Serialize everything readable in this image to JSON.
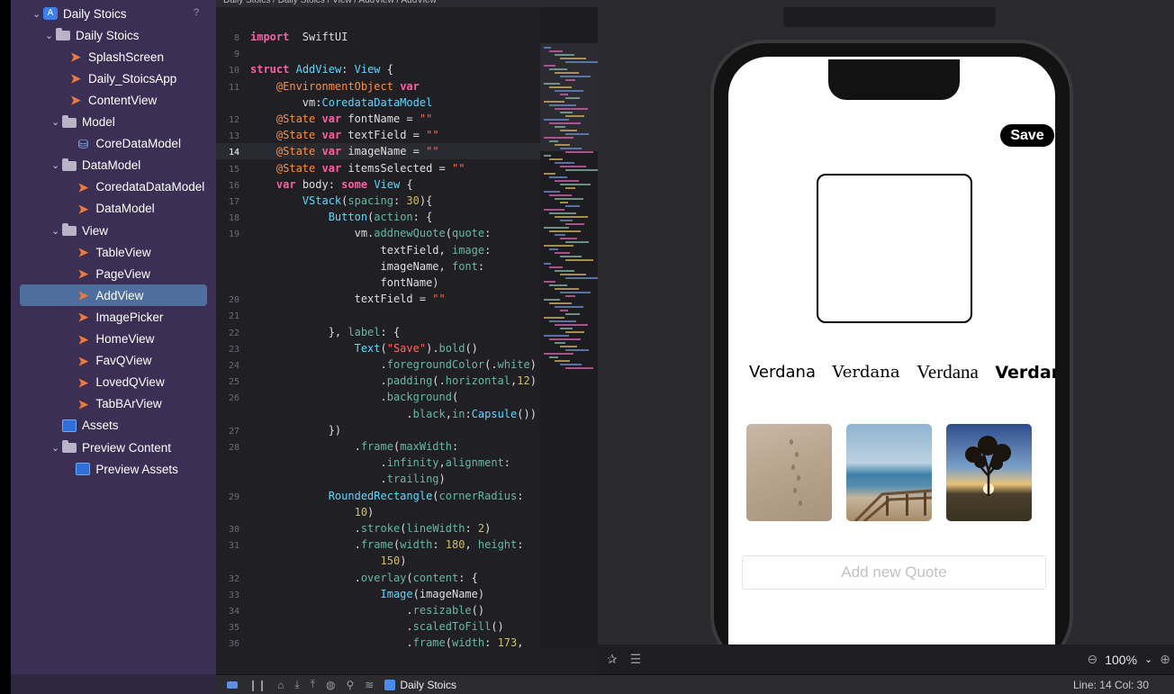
{
  "navigator": {
    "help_mark": "?",
    "tree": [
      {
        "label": "Daily Stoics",
        "icon": "project-icon",
        "indent": 0,
        "chev": "⌄"
      },
      {
        "label": "Daily Stoics",
        "icon": "folder-icon",
        "indent": 1,
        "chev": "⌄"
      },
      {
        "label": "SplashScreen",
        "icon": "swift-file-icon",
        "indent": 2
      },
      {
        "label": "Daily_StoicsApp",
        "icon": "swift-file-icon",
        "indent": 2
      },
      {
        "label": "ContentView",
        "icon": "swift-file-icon",
        "indent": 2
      },
      {
        "label": "Model",
        "icon": "folder-icon",
        "indent": 1.5,
        "chev": "⌄"
      },
      {
        "label": "CoreDataModel",
        "icon": "coredata-icon",
        "indent": 2.6
      },
      {
        "label": "DataModel",
        "icon": "folder-icon",
        "indent": 1.5,
        "chev": "⌄"
      },
      {
        "label": "CoredataDataModel",
        "icon": "swift-file-icon",
        "indent": 2.6
      },
      {
        "label": "DataModel",
        "icon": "swift-file-icon",
        "indent": 2.6
      },
      {
        "label": "View",
        "icon": "folder-icon",
        "indent": 1.5,
        "chev": "⌄"
      },
      {
        "label": "TableView",
        "icon": "swift-file-icon",
        "indent": 2.6
      },
      {
        "label": "PageView",
        "icon": "swift-file-icon",
        "indent": 2.6
      },
      {
        "label": "AddView",
        "icon": "swift-file-icon",
        "indent": 2.6,
        "selected": true
      },
      {
        "label": "ImagePicker",
        "icon": "swift-file-icon",
        "indent": 2.6
      },
      {
        "label": "HomeView",
        "icon": "swift-file-icon",
        "indent": 2.6
      },
      {
        "label": "FavQView",
        "icon": "swift-file-icon",
        "indent": 2.6
      },
      {
        "label": "LovedQView",
        "icon": "swift-file-icon",
        "indent": 2.6
      },
      {
        "label": "TabBArView",
        "icon": "swift-file-icon",
        "indent": 2.6
      },
      {
        "label": "Assets",
        "icon": "assets-icon",
        "indent": 1.5
      },
      {
        "label": "Preview Content",
        "icon": "folder-icon",
        "indent": 1.5,
        "chev": "⌄"
      },
      {
        "label": "Preview Assets",
        "icon": "assets-icon",
        "indent": 2.6
      }
    ]
  },
  "editor": {
    "breadcrumb": "Daily Stoics / Daily Stoics / View / AddView / AddView",
    "current_line_index": 6,
    "lines": [
      {
        "n": "8",
        "t": [
          [
            "kw",
            "import"
          ],
          [
            "",
            "  SwiftUI"
          ]
        ]
      },
      {
        "n": "9",
        "t": []
      },
      {
        "n": "10",
        "t": [
          [
            "kw",
            "struct"
          ],
          [
            "",
            " "
          ],
          [
            "ty",
            "AddView"
          ],
          [
            "",
            ": "
          ],
          [
            "ty",
            "View"
          ],
          [
            "",
            " {"
          ]
        ]
      },
      {
        "n": "11",
        "t": [
          [
            "",
            "    "
          ],
          [
            "at",
            "@EnvironmentObject"
          ],
          [
            "",
            " "
          ],
          [
            "kw",
            "var"
          ]
        ]
      },
      {
        "n": "",
        "t": [
          [
            "",
            "        vm:"
          ],
          [
            "ty",
            "CoredataDataModel"
          ]
        ]
      },
      {
        "n": "12",
        "t": [
          [
            "",
            "    "
          ],
          [
            "at",
            "@State"
          ],
          [
            "",
            " "
          ],
          [
            "kw",
            "var"
          ],
          [
            "",
            " fontName = "
          ],
          [
            "str",
            "\"\""
          ]
        ]
      },
      {
        "n": "13",
        "t": [
          [
            "",
            "    "
          ],
          [
            "at",
            "@State"
          ],
          [
            "",
            " "
          ],
          [
            "kw",
            "var"
          ],
          [
            "",
            " textField = "
          ],
          [
            "str",
            "\"\""
          ]
        ]
      },
      {
        "n": "14",
        "t": [
          [
            "",
            "    "
          ],
          [
            "at",
            "@State"
          ],
          [
            "",
            " "
          ],
          [
            "kw",
            "var"
          ],
          [
            "",
            " imageName = "
          ],
          [
            "str",
            "\"\""
          ]
        ]
      },
      {
        "n": "15",
        "t": [
          [
            "",
            "    "
          ],
          [
            "at",
            "@State"
          ],
          [
            "",
            " "
          ],
          [
            "kw",
            "var"
          ],
          [
            "",
            " itemsSelected = "
          ],
          [
            "str",
            "\"\""
          ]
        ]
      },
      {
        "n": "16",
        "t": [
          [
            "",
            "    "
          ],
          [
            "kw",
            "var"
          ],
          [
            "",
            " body: "
          ],
          [
            "kw",
            "some"
          ],
          [
            "",
            " "
          ],
          [
            "ty",
            "View"
          ],
          [
            "",
            " {"
          ]
        ]
      },
      {
        "n": "17",
        "t": [
          [
            "",
            "        "
          ],
          [
            "ty",
            "VStack"
          ],
          [
            "",
            "("
          ],
          [
            "pl",
            "spacing"
          ],
          [
            "",
            ": "
          ],
          [
            "num",
            "30"
          ],
          [
            "",
            "){"
          ]
        ]
      },
      {
        "n": "18",
        "t": [
          [
            "",
            "            "
          ],
          [
            "ty",
            "Button"
          ],
          [
            "",
            "("
          ],
          [
            "pl",
            "action"
          ],
          [
            "",
            ": {"
          ]
        ]
      },
      {
        "n": "19",
        "t": [
          [
            "",
            "                vm."
          ],
          [
            "pl",
            "addnewQuote"
          ],
          [
            "",
            "("
          ],
          [
            "pl",
            "quote"
          ],
          [
            "",
            ":"
          ]
        ]
      },
      {
        "n": "",
        "t": [
          [
            "",
            "                    textField, "
          ],
          [
            "pl",
            "image"
          ],
          [
            "",
            ":"
          ]
        ]
      },
      {
        "n": "",
        "t": [
          [
            "",
            "                    imageName, "
          ],
          [
            "pl",
            "font"
          ],
          [
            "",
            ":"
          ]
        ]
      },
      {
        "n": "",
        "t": [
          [
            "",
            "                    fontName)"
          ]
        ]
      },
      {
        "n": "20",
        "t": [
          [
            "",
            "                textField = "
          ],
          [
            "str",
            "\"\""
          ]
        ]
      },
      {
        "n": "21",
        "t": []
      },
      {
        "n": "22",
        "t": [
          [
            "",
            "            }, "
          ],
          [
            "pl",
            "label"
          ],
          [
            "",
            ": {"
          ]
        ]
      },
      {
        "n": "23",
        "t": [
          [
            "",
            "                "
          ],
          [
            "ty",
            "Text"
          ],
          [
            "",
            "("
          ],
          [
            "str",
            "\"Save\""
          ],
          [
            "",
            ")."
          ],
          [
            "pl",
            "bold"
          ],
          [
            "",
            "()"
          ]
        ]
      },
      {
        "n": "24",
        "t": [
          [
            "",
            "                    ."
          ],
          [
            "pl",
            "foregroundColor"
          ],
          [
            "",
            "(."
          ],
          [
            "pl",
            "white"
          ],
          [
            "",
            ")"
          ]
        ]
      },
      {
        "n": "25",
        "t": [
          [
            "",
            "                    ."
          ],
          [
            "pl",
            "padding"
          ],
          [
            "",
            "(."
          ],
          [
            "pl",
            "horizontal"
          ],
          [
            "",
            ","
          ],
          [
            "num",
            "12"
          ],
          [
            "",
            ")"
          ]
        ]
      },
      {
        "n": "26",
        "t": [
          [
            "",
            "                    ."
          ],
          [
            "pl",
            "background"
          ],
          [
            "",
            "("
          ]
        ]
      },
      {
        "n": "",
        "t": [
          [
            "",
            "                        ."
          ],
          [
            "pl",
            "black"
          ],
          [
            "",
            ","
          ],
          [
            "pl",
            "in"
          ],
          [
            "",
            ":"
          ],
          [
            "ty",
            "Capsule"
          ],
          [
            "",
            "())"
          ]
        ]
      },
      {
        "n": "27",
        "t": [
          [
            "",
            "            })"
          ]
        ]
      },
      {
        "n": "28",
        "t": [
          [
            "",
            "                ."
          ],
          [
            "pl",
            "frame"
          ],
          [
            "",
            "("
          ],
          [
            "pl",
            "maxWidth"
          ],
          [
            "",
            ":"
          ]
        ]
      },
      {
        "n": "",
        "t": [
          [
            "",
            "                    ."
          ],
          [
            "pl",
            "infinity"
          ],
          [
            "",
            ","
          ],
          [
            "pl",
            "alignment"
          ],
          [
            "",
            ":"
          ]
        ]
      },
      {
        "n": "",
        "t": [
          [
            "",
            "                    ."
          ],
          [
            "pl",
            "trailing"
          ],
          [
            "",
            ")"
          ]
        ]
      },
      {
        "n": "29",
        "t": [
          [
            "",
            "            "
          ],
          [
            "ty",
            "RoundedRectangle"
          ],
          [
            "",
            "("
          ],
          [
            "pl",
            "cornerRadius"
          ],
          [
            "",
            ":"
          ]
        ]
      },
      {
        "n": "",
        "t": [
          [
            "",
            "                "
          ],
          [
            "num",
            "10"
          ],
          [
            "",
            ")"
          ]
        ]
      },
      {
        "n": "30",
        "t": [
          [
            "",
            "                ."
          ],
          [
            "pl",
            "stroke"
          ],
          [
            "",
            "("
          ],
          [
            "pl",
            "lineWidth"
          ],
          [
            "",
            ": "
          ],
          [
            "num",
            "2"
          ],
          [
            "",
            ")"
          ]
        ]
      },
      {
        "n": "31",
        "t": [
          [
            "",
            "                ."
          ],
          [
            "pl",
            "frame"
          ],
          [
            "",
            "("
          ],
          [
            "pl",
            "width"
          ],
          [
            "",
            ": "
          ],
          [
            "num",
            "180"
          ],
          [
            "",
            ", "
          ],
          [
            "pl",
            "height"
          ],
          [
            "",
            ":"
          ]
        ]
      },
      {
        "n": "",
        "t": [
          [
            "",
            "                    "
          ],
          [
            "num",
            "150"
          ],
          [
            "",
            ")"
          ]
        ]
      },
      {
        "n": "32",
        "t": [
          [
            "",
            "                ."
          ],
          [
            "pl",
            "overlay"
          ],
          [
            "",
            "("
          ],
          [
            "pl",
            "content"
          ],
          [
            "",
            ": {"
          ]
        ]
      },
      {
        "n": "33",
        "t": [
          [
            "",
            "                    "
          ],
          [
            "ty",
            "Image"
          ],
          [
            "",
            "(imageName)"
          ]
        ]
      },
      {
        "n": "34",
        "t": [
          [
            "",
            "                        ."
          ],
          [
            "pl",
            "resizable"
          ],
          [
            "",
            "()"
          ]
        ]
      },
      {
        "n": "35",
        "t": [
          [
            "",
            "                        ."
          ],
          [
            "pl",
            "scaledToFill"
          ],
          [
            "",
            "()"
          ]
        ]
      },
      {
        "n": "36",
        "t": [
          [
            "",
            "                        ."
          ],
          [
            "pl",
            "frame"
          ],
          [
            "",
            "("
          ],
          [
            "pl",
            "width"
          ],
          [
            "",
            ": "
          ],
          [
            "num",
            "173"
          ],
          [
            "",
            ","
          ]
        ]
      }
    ],
    "scheme": "Daily Stoics"
  },
  "preview": {
    "save_label": "Save",
    "fonts": [
      "Verdana",
      "Verdana",
      "Verdana",
      "Verdana"
    ],
    "thumbnails": [
      "sand-footprints",
      "beach-pier",
      "tree-sunset"
    ],
    "quote_placeholder": "Add new Quote",
    "zoom": "100%",
    "cursor_position": "Line: 14  Col: 30"
  },
  "colors": {
    "navigator_bg": "#3b2f55",
    "selection": "#4e6e9e",
    "editor_bg": "#1f1f24",
    "keyword": "#fc5fa3",
    "type": "#5dd8ff",
    "string": "#fc6a5d",
    "number": "#d0bf69"
  }
}
